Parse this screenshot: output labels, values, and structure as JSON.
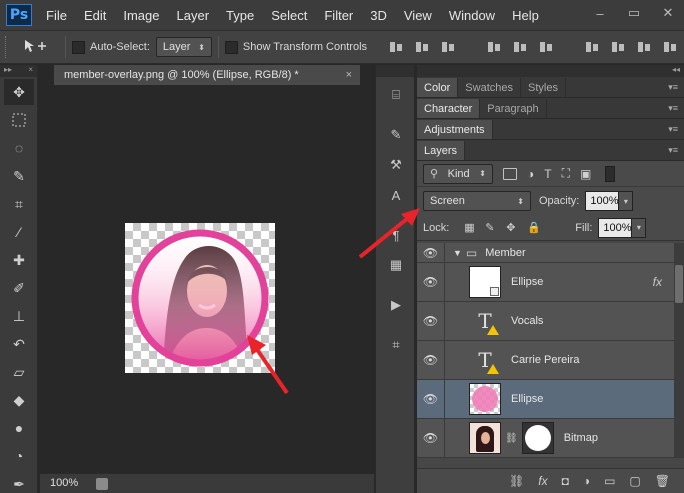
{
  "app": {
    "logo": "Ps",
    "menu": [
      "File",
      "Edit",
      "Image",
      "Layer",
      "Type",
      "Select",
      "Filter",
      "3D",
      "View",
      "Window",
      "Help"
    ],
    "window_controls": [
      "–",
      "▭",
      "✕"
    ]
  },
  "options": {
    "move_tool_icon": "move-tool-icon",
    "auto_select_label": "Auto-Select:",
    "auto_select_target": "Layer",
    "show_transform_label": "Show Transform Controls",
    "auto_select_checked": false,
    "show_transform_checked": false
  },
  "document": {
    "tab_title": "member-overlay.png @ 100% (Ellipse, RGB/8) *",
    "close_glyph": "×",
    "zoom": "100%"
  },
  "panels": {
    "row1_tabs": [
      "Color",
      "Swatches",
      "Styles"
    ],
    "row2_tabs": [
      "Character",
      "Paragraph"
    ],
    "row3_tabs": [
      "Adjustments"
    ],
    "row4_tabs": [
      "Layers"
    ],
    "panel_menu_glyph": "▾≡"
  },
  "layers": {
    "kind_label": "Kind",
    "blend_mode": "Screen",
    "opacity_label": "Opacity:",
    "opacity_value": "100%",
    "lock_label": "Lock:",
    "fill_label": "Fill:",
    "fill_value": "100%",
    "items": [
      {
        "name": "Member",
        "type": "group",
        "visible": true,
        "selected": false
      },
      {
        "name": "Ellipse",
        "type": "shape",
        "visible": true,
        "selected": false,
        "fx": "fx"
      },
      {
        "name": "Vocals",
        "type": "text",
        "visible": true,
        "selected": false
      },
      {
        "name": "Carrie Pereira",
        "type": "text",
        "visible": true,
        "selected": false
      },
      {
        "name": "Ellipse",
        "type": "pink",
        "visible": true,
        "selected": true
      },
      {
        "name": "Bitmap",
        "type": "bitmap",
        "visible": true,
        "selected": false
      }
    ]
  },
  "colors": {
    "accent_pink": "#e2429a",
    "selected_row": "#5b6b7c",
    "annotation_arrow": "#e8242a"
  }
}
